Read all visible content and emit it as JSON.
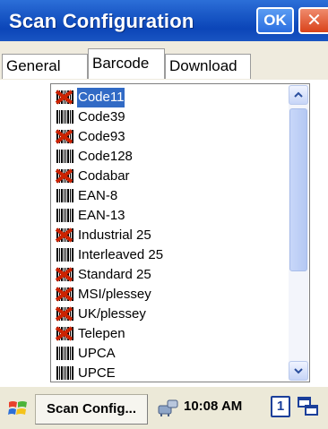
{
  "window": {
    "title": "Scan Configuration",
    "ok_label": "OK",
    "close_label": "✕"
  },
  "tabs": [
    {
      "label": "General",
      "active": false
    },
    {
      "label": "Barcode",
      "active": true
    },
    {
      "label": "Download",
      "active": false
    }
  ],
  "barcode_list": {
    "items": [
      {
        "label": "Code11",
        "enabled": true,
        "selected": true
      },
      {
        "label": "Code39",
        "enabled": false,
        "selected": false
      },
      {
        "label": "Code93",
        "enabled": true,
        "selected": false
      },
      {
        "label": "Code128",
        "enabled": false,
        "selected": false
      },
      {
        "label": "Codabar",
        "enabled": true,
        "selected": false
      },
      {
        "label": "EAN-8",
        "enabled": false,
        "selected": false
      },
      {
        "label": "EAN-13",
        "enabled": false,
        "selected": false
      },
      {
        "label": "Industrial 25",
        "enabled": true,
        "selected": false
      },
      {
        "label": "Interleaved 25",
        "enabled": false,
        "selected": false
      },
      {
        "label": "Standard 25",
        "enabled": true,
        "selected": false
      },
      {
        "label": "MSI/plessey",
        "enabled": true,
        "selected": false
      },
      {
        "label": "UK/plessey",
        "enabled": true,
        "selected": false
      },
      {
        "label": "Telepen",
        "enabled": true,
        "selected": false
      },
      {
        "label": "UPCA",
        "enabled": false,
        "selected": false
      },
      {
        "label": "UPCE",
        "enabled": false,
        "selected": false
      }
    ],
    "icons": {
      "enabled": "barcode-enabled-icon",
      "disabled": "barcode-disabled-icon"
    },
    "colors": {
      "selection": "#316ac5",
      "disabled_mark": "#cc2200"
    }
  },
  "taskbar": {
    "task_label": "Scan Config...",
    "clock": "10:08 AM",
    "desktop_number": "1"
  },
  "theme": {
    "titlebar": "#0b45b8",
    "ok_button": "#2b6ee0",
    "close_button": "#d9421a"
  }
}
